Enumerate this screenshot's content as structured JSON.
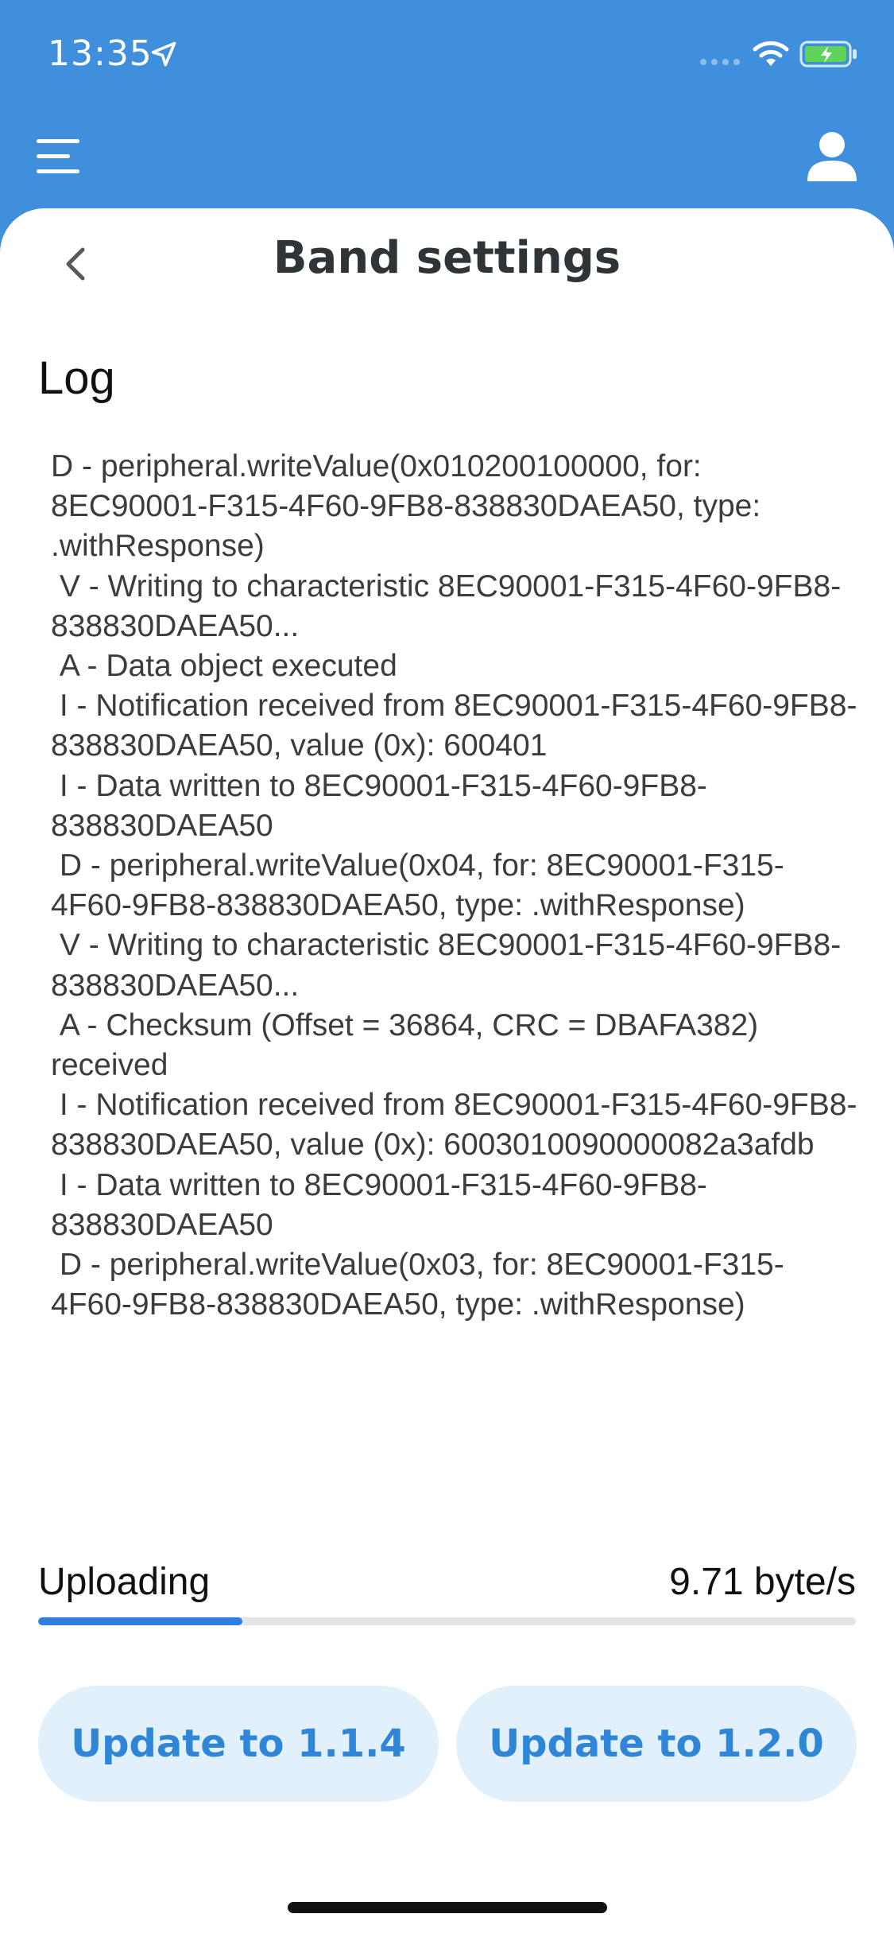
{
  "status_bar": {
    "time": "13:35",
    "icons": [
      "location-arrow-icon",
      "cellular-signal-icon",
      "wifi-icon",
      "battery-charging-icon"
    ]
  },
  "nav": {
    "icons": [
      "hamburger-menu-icon",
      "user-profile-icon"
    ]
  },
  "header": {
    "title": "Band settings",
    "back_icon": "chevron-left-icon"
  },
  "log": {
    "title": "Log",
    "text": "D - peripheral.writeValue(0x010200100000, for: 8EC90001-F315-4F60-9FB8-838830DAEA50, type: .withResponse)\n V - Writing to characteristic 8EC90001-F315-4F60-9FB8-838830DAEA50...\n A - Data object executed\n I - Notification received from 8EC90001-F315-4F60-9FB8-838830DAEA50, value (0x): 600401\n I - Data written to 8EC90001-F315-4F60-9FB8-838830DAEA50\n D - peripheral.writeValue(0x04, for: 8EC90001-F315-4F60-9FB8-838830DAEA50, type: .withResponse)\n V - Writing to characteristic 8EC90001-F315-4F60-9FB8-838830DAEA50...\n A - Checksum (Offset = 36864, CRC = DBAFA382) received\n I - Notification received from 8EC90001-F315-4F60-9FB8-838830DAEA50, value (0x): 6003010090000082a3afdb\n I - Data written to 8EC90001-F315-4F60-9FB8-838830DAEA50\n D - peripheral.writeValue(0x03, for: 8EC90001-F315-4F60-9FB8-838830DAEA50, type: .withResponse)"
  },
  "upload": {
    "label": "Uploading",
    "rate": "9.71 byte/s",
    "progress_fraction": 0.25
  },
  "actions": {
    "update_114_label": "Update to 1.1.4",
    "update_120_label": "Update to 1.2.0"
  },
  "colors": {
    "header_bg": "#3f8fdc",
    "progress_fill": "#2f7fe0",
    "button_bg": "#e1f0fa",
    "button_text": "#2f86d6"
  }
}
